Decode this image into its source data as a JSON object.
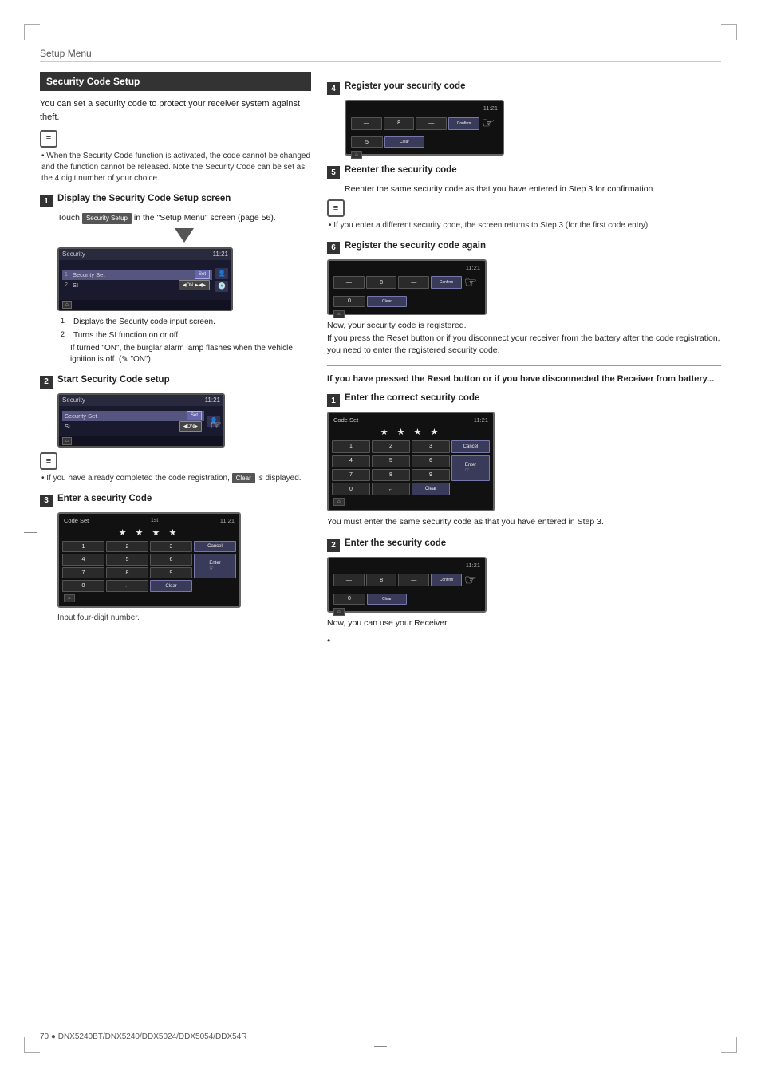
{
  "page": {
    "section_header": "Setup Menu",
    "footer_text": "70 ● DNX5240BT/DNX5240/DDX5024/DDX5054/DDX54R"
  },
  "left_col": {
    "box_title": "Security Code Setup",
    "intro_text": "You can set a security code to protect your receiver system against theft.",
    "note_text": "• When the Security Code function is activated, the code cannot be changed and the function cannot be released. Note the Security Code can be set as the 4 digit number of your choice.",
    "steps": [
      {
        "num": "1",
        "title": "Display the Security Code Setup screen",
        "body_line1": "Touch",
        "inline_btn": "Security Setup",
        "body_line2": "in the \"Setup Menu\" screen (page 56).",
        "screen": {
          "label": "Security",
          "time": "11:21",
          "items": [
            "1  Security Set",
            "2  SI"
          ],
          "btns": [
            "Set",
            "▶ON ◀ ▶"
          ],
          "show_arrow": true
        },
        "numbered_items": [
          "Displays the Security code input screen.",
          "Turns the SI function on or off."
        ],
        "sub_text": "If turned \"ON\", the burglar alarm lamp flashes when the vehicle ignition is off. (✎ \"ON\")"
      },
      {
        "num": "2",
        "title": "Start Security Code setup",
        "screen": {
          "label": "Security",
          "time": "11:21",
          "items": [
            "Security Set",
            "Si"
          ],
          "btn": "Set",
          "show_hand": true
        },
        "note2_text": "• If you have already completed the code registration,",
        "inline_btn2": "Clear",
        "note2_text2": "is displayed."
      },
      {
        "num": "3",
        "title": "Enter a security Code",
        "keypad_label": "Code Set",
        "keypad_time": "11:21",
        "footer_note": "Input four-digit number."
      }
    ]
  },
  "right_col": {
    "steps": [
      {
        "num": "4",
        "title": "Register your security code"
      },
      {
        "num": "5",
        "title": "Reenter the security code",
        "body_text": "Reenter the same security code as that you have entered in Step 3 for confirmation.",
        "note_text": "• If you enter a different security code, the screen returns to Step 3 (for the first code entry)."
      },
      {
        "num": "6",
        "title": "Register the security code again",
        "after_text_lines": [
          "Now, your security code is registered.",
          "If you press the Reset button or if you disconnect your receiver from the battery after the code registration, you need to enter the registered security code."
        ]
      }
    ],
    "bold_section_title": "If you have pressed the Reset button or if you have disconnected the Receiver from battery...",
    "reset_steps": [
      {
        "num": "1",
        "title": "Enter the correct security code",
        "after_text": "You must enter the same security code as that you have entered in Step 3."
      },
      {
        "num": "2",
        "title": "Enter the security code",
        "after_text": "Now, you can use your Receiver."
      }
    ]
  }
}
